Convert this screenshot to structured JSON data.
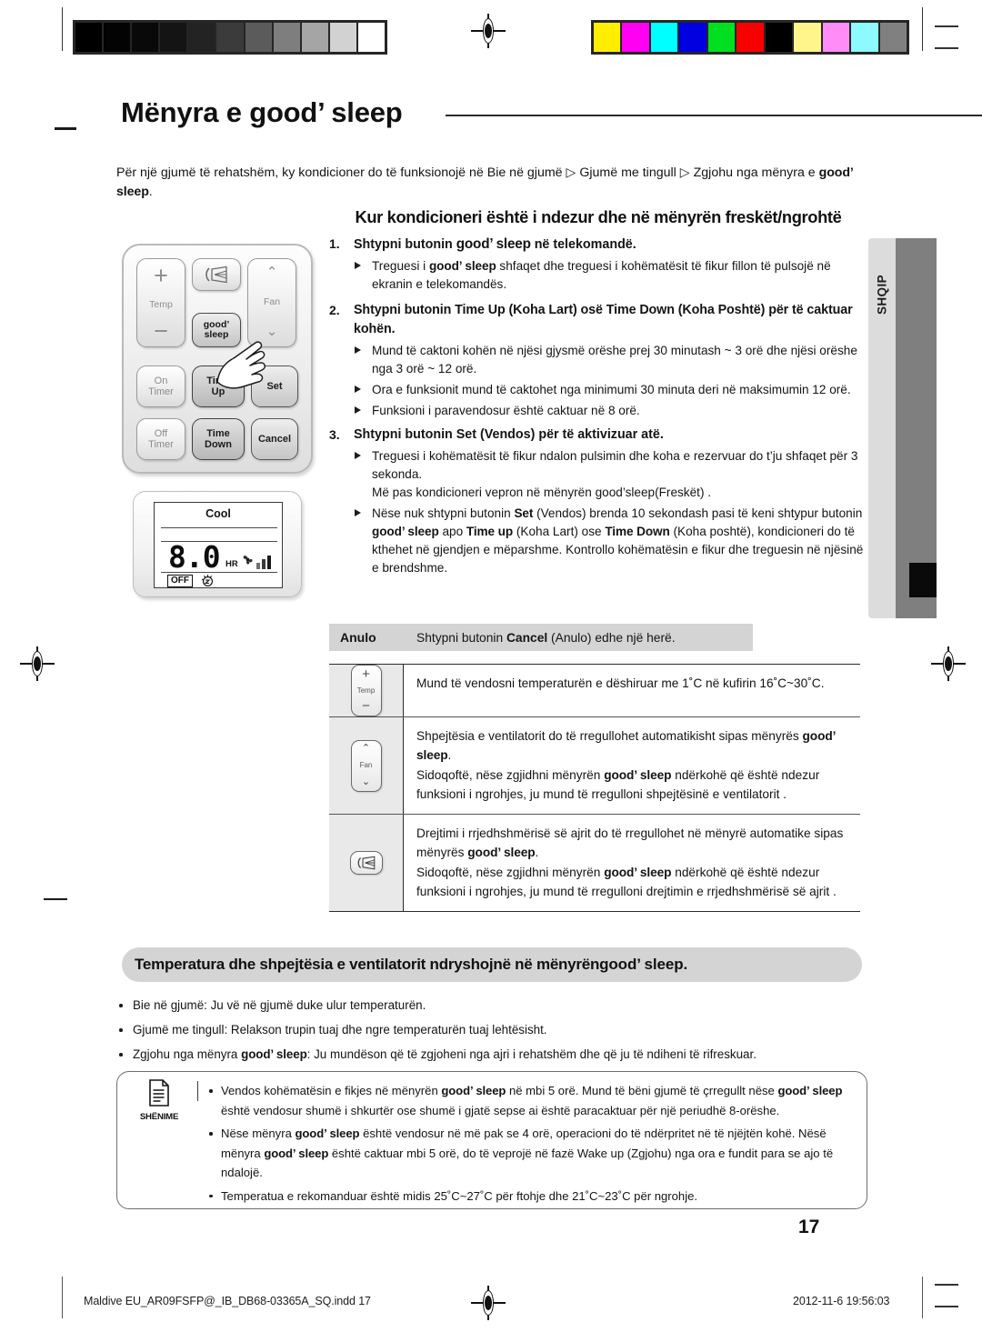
{
  "document": {
    "title": "Mënyra e good’ sleep",
    "intro_prefix": "Për një gjumë të rehatshëm, ky kondicioner do të funksionojë në Bie në gjumë ",
    "intro_arrow1": "▷",
    "intro_mid": " Gjumë me tingull ",
    "intro_arrow2": "▷",
    "intro_suffix": " Zgjohu nga mënyra e",
    "intro_bold_tail": "good’ sleep",
    "intro_period": ".",
    "subheading": "Kur kondicioneri është i ndezur dhe në mënyrën freskët/ngrohtë"
  },
  "side_tab": {
    "label": "SHQIP"
  },
  "remote": {
    "buttons": {
      "temp_plus": "+",
      "temp_label": "Temp",
      "temp_minus": "−",
      "swing_icon": "air-swing-icon",
      "fan_up": "⌃",
      "fan_label": "Fan",
      "fan_down": "⌄",
      "good_sleep_line1": "good’",
      "good_sleep_line2": "sleep",
      "on_timer_line1": "On",
      "on_timer_line2": "Timer",
      "time_up_line1": "Time",
      "time_up_line2": "Up",
      "set": "Set",
      "off_timer_line1": "Off",
      "off_timer_line2": "Timer",
      "time_down_line1": "Time",
      "time_down_line2": "Down",
      "cancel": "Cancel"
    }
  },
  "lcd": {
    "mode": "Cool",
    "digits": "8.0",
    "hr_unit": "HR",
    "off_badge": "OFF",
    "fan_icon": "fan-icon",
    "sleep_icon": "sleep-moon-icon",
    "fan_bars": 3
  },
  "steps": [
    {
      "num": "1.",
      "head_prefix": "Shtypni butonin ",
      "head_bold": "good’ sleep",
      "head_suffix": " në telekomandë.",
      "subs": [
        {
          "segments": [
            {
              "t": "Treguesi i ",
              "b": false
            },
            {
              "t": "good’ sleep",
              "b": true
            },
            {
              "t": " shfaqet dhe treguesi i kohëmatësit të fikur fillon të pulsojë në ekranin e telekomandës.",
              "b": false
            }
          ]
        }
      ]
    },
    {
      "num": "2.",
      "head_segments": [
        {
          "t": "Shtypni butonin ",
          "b": true
        },
        {
          "t": "Time Up",
          "b": true
        },
        {
          "t": " (Koha Lart) ",
          "b": true
        },
        {
          "t": "osë ",
          "b": true
        },
        {
          "t": "Time Down",
          "b": true
        },
        {
          "t": " (Koha Poshtë) për të caktuar kohën.",
          "b": true
        }
      ],
      "subs": [
        {
          "segments": [
            {
              "t": "Mund të caktoni kohën në njësi gjysmë orëshe prej 30 minutash ~ 3 orë dhe njësi orëshe nga 3 orë ~ 12 orë.",
              "b": false
            }
          ]
        },
        {
          "segments": [
            {
              "t": "Ora e funksionit mund të caktohet nga minimumi 30 minuta deri në maksimumin 12 orë.",
              "b": false
            }
          ]
        },
        {
          "segments": [
            {
              "t": "Funksioni i paravendosur është caktuar në 8 orë.",
              "b": false
            }
          ]
        }
      ]
    },
    {
      "num": "3.",
      "head_prefix": "Shtypni butonin ",
      "head_bold": "Set",
      "head_suffix": " (Vendos) për të aktivizuar atë.",
      "subs": [
        {
          "segments": [
            {
              "t": "Treguesi i kohëmatësit të fikur ndalon pulsimin dhe koha e rezervuar do t’ju shfaqet për 3 sekonda.",
              "b": false
            },
            {
              "t": "\nMë pas kondicioneri vepron në mënyrën good’sleep(Freskët) .",
              "b": false
            }
          ]
        },
        {
          "segments": [
            {
              "t": "Nëse nuk shtypni butonin ",
              "b": false
            },
            {
              "t": "Set",
              "b": true
            },
            {
              "t": " (Vendos) brenda 10 sekondash pasi të keni shtypur butonin ",
              "b": false
            },
            {
              "t": "good’ sleep",
              "b": true
            },
            {
              "t": " apo ",
              "b": false
            },
            {
              "t": "Time up",
              "b": true
            },
            {
              "t": " (Koha Lart) ose ",
              "b": false
            },
            {
              "t": "Time Down",
              "b": true
            },
            {
              "t": " (Koha poshtë), kondicioneri do të kthehet në gjendjen e mëparshme.  Kontrollo kohëmatësin e fikur dhe treguesin në njësinë e brendshme.",
              "b": false
            }
          ]
        }
      ]
    }
  ],
  "cancel_row": {
    "label": "Anulo",
    "text_prefix": "Shtypni butonin ",
    "text_bold": "Cancel",
    "text_suffix": " (Anulo) edhe një herë."
  },
  "feature_table": {
    "rows": [
      {
        "icon": "temp-button-icon",
        "icon_parts": {
          "plus": "+",
          "label": "Temp",
          "minus": "−"
        },
        "paragraphs": [
          [
            {
              "t": "Mund të vendosni temperaturën e dëshiruar me 1˚C në kufirin 16˚C~30˚C.",
              "b": false
            }
          ]
        ]
      },
      {
        "icon": "fan-button-icon",
        "icon_parts": {
          "up": "⌃",
          "label": "Fan",
          "down": "⌄"
        },
        "paragraphs": [
          [
            {
              "t": "Shpejtësia e ventilatorit do të rregullohet automatikisht sipas mënyrës ",
              "b": false
            },
            {
              "t": "good’ sleep",
              "b": true
            },
            {
              "t": ".",
              "b": false
            }
          ],
          [
            {
              "t": "Sidoqoftë, nëse zgjidhni mënyrën ",
              "b": false
            },
            {
              "t": "good’ sleep",
              "b": true
            },
            {
              "t": " ndërkohë që është ndezur funksioni i ngrohjes, ju mund të rregulloni shpejtësinë e ventilatorit .",
              "b": false
            }
          ]
        ]
      },
      {
        "icon": "air-swing-button-icon",
        "icon_parts": {},
        "paragraphs": [
          [
            {
              "t": "Drejtimi i rrjedhshmërisë së ajrit do të rregullohet në mënyrë automatike sipas mënyrës ",
              "b": false
            },
            {
              "t": "good’ sleep",
              "b": true
            },
            {
              "t": ".",
              "b": false
            }
          ],
          [
            {
              "t": "Sidoqoftë, nëse zgjidhni mënyrën ",
              "b": false
            },
            {
              "t": "good’ sleep",
              "b": true
            },
            {
              "t": " ndërkohë që është ndezur funksioni i ngrohjes, ju mund të rregulloni drejtimin e rrjedhshmërisë së ajrit .",
              "b": false
            }
          ]
        ]
      }
    ]
  },
  "mode_section": {
    "heading_prefix": "Temperatura dhe shpejtësia e ventilatorit ndryshojnë në mënyrën ",
    "heading_bold": "good’ sleep",
    "heading_suffix": " .",
    "bullets": [
      [
        {
          "t": "Bie në gjumë: Ju vë në gjumë duke ulur temperaturën.",
          "b": false
        }
      ],
      [
        {
          "t": "Gjumë me tingull: Relakson trupin tuaj dhe ngre temperaturën tuaj lehtësisht.",
          "b": false
        }
      ],
      [
        {
          "t": "Zgjohu nga mënyra ",
          "b": false
        },
        {
          "t": "good’ sleep",
          "b": true
        },
        {
          "t": ": Ju mundëson që të zgjoheni nga ajri i rehatshëm dhe që ju të ndiheni të rifreskuar.",
          "b": false
        }
      ]
    ]
  },
  "note": {
    "icon": "note-document-icon",
    "label": "SHËNIME",
    "items": [
      [
        {
          "t": "Vendos kohëmatësin e fikjes në mënyrën  ",
          "b": false
        },
        {
          "t": "good’ sleep",
          "b": true
        },
        {
          "t": " në mbi 5 orë. Mund të bëni gjumë të çrregullt nëse ",
          "b": false
        },
        {
          "t": "good’ sleep",
          "b": true
        },
        {
          "t": " është vendosur shumë i shkurtër ose shumë i gjatë sepse ai është paracaktuar për një periudhë 8-orëshe.",
          "b": false
        }
      ],
      [
        {
          "t": "Nëse mënyra ",
          "b": false
        },
        {
          "t": "good’ sleep",
          "b": true
        },
        {
          "t": " është vendosur në më pak se 4 orë, operacioni do të ndërpritet në të njëjtën kohë. Nësë mënyra ",
          "b": false
        },
        {
          "t": "good’ sleep",
          "b": true
        },
        {
          "t": " është caktuar mbi 5 orë, do të veprojë në fazë Wake up (Zgjohu) nga ora e fundit para se ajo të ndalojë.",
          "b": false
        }
      ],
      [
        {
          "t": "Temperatua e rekomanduar është midis 25˚C~27˚C për ftohje dhe 21˚C~23˚C për ngrohje.",
          "b": false
        }
      ]
    ]
  },
  "page_number": "17",
  "footer": {
    "left": "Maldive EU_AR09FSFP@_IB_DB68-03365A_SQ.indd   17",
    "right": "2012-11-6   19:56:03"
  },
  "calibration": {
    "gray_swatches": [
      "#000000",
      "#030303",
      "#090909",
      "#141414",
      "#232323",
      "#3b3b3b",
      "#5b5b5b",
      "#7e7e7e",
      "#a5a5a5",
      "#d2d2d2",
      "#ffffff"
    ],
    "color_swatches": [
      "#ffee00",
      "#ff00f2",
      "#00ffff",
      "#0000e0",
      "#00e020",
      "#f90000",
      "#000000",
      "#fff58a",
      "#ff8cf7",
      "#8cfaff",
      "#808080"
    ]
  }
}
